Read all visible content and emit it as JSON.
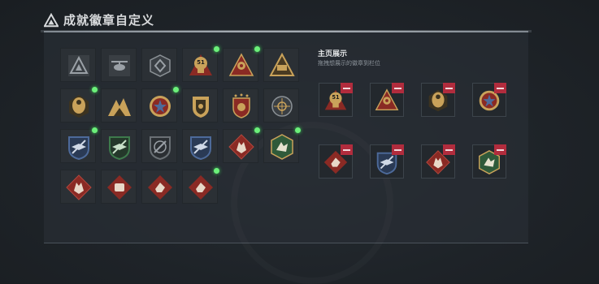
{
  "header": {
    "title": "成就徽章自定义",
    "icon": "triangle-logo-icon"
  },
  "showcase": {
    "title": "主页展示",
    "subtitle": "拖拽想展示的徽章到栏位"
  },
  "colors": {
    "new_dot": "#6cf07a",
    "remove": "#b12c3d",
    "gold": "#c9a25a",
    "red_badge": "#8a2a24",
    "blue_badge": "#4d6a9a",
    "green_badge": "#3e7a4c"
  },
  "badges": [
    {
      "icon": "triangle-emblem-icon",
      "new": false
    },
    {
      "icon": "helicopter-emblem-icon",
      "new": false
    },
    {
      "icon": "diamond-emblem-icon",
      "new": false
    },
    {
      "icon": "lightbulb-51-badge-icon",
      "new": true,
      "label": "51"
    },
    {
      "icon": "pyramid-eye-badge-icon",
      "new": true
    },
    {
      "icon": "triangle-crest-icon",
      "new": false
    },
    {
      "icon": "eagle-gold-badge-icon",
      "new": true
    },
    {
      "icon": "mountain-gold-badge-icon",
      "new": false
    },
    {
      "icon": "star-medal-badge-icon",
      "new": true
    },
    {
      "icon": "gold-shield-badge-icon",
      "new": false
    },
    {
      "icon": "stars-shield-badge-icon",
      "new": false
    },
    {
      "icon": "crosshair-badge-icon",
      "new": false
    },
    {
      "icon": "blue-wings-badge-icon",
      "new": true
    },
    {
      "icon": "green-wings-badge-icon",
      "new": false
    },
    {
      "icon": "dark-wings-badge-icon",
      "new": false
    },
    {
      "icon": "blue-wings-badge-icon-2",
      "new": false
    },
    {
      "icon": "wolf-red-badge-icon",
      "new": true
    },
    {
      "icon": "hex-green-badge-icon",
      "new": true
    },
    {
      "icon": "wolf-red-badge-icon-2",
      "new": false
    },
    {
      "icon": "fist-red-badge-icon",
      "new": false
    },
    {
      "icon": "hand-red-badge-icon",
      "new": false
    },
    {
      "icon": "hand-red-badge-icon-2",
      "new": true
    }
  ],
  "slots": [
    {
      "icon": "lightbulb-51-badge-icon",
      "label": "51"
    },
    {
      "icon": "pyramid-eye-badge-icon"
    },
    {
      "icon": "eagle-gold-badge-icon"
    },
    {
      "icon": "star-medal-badge-icon"
    },
    {
      "icon": "hand-red-badge-icon"
    },
    {
      "icon": "blue-wings-badge-icon"
    },
    {
      "icon": "wolf-red-badge-icon"
    },
    {
      "icon": "hex-green-badge-icon"
    }
  ]
}
